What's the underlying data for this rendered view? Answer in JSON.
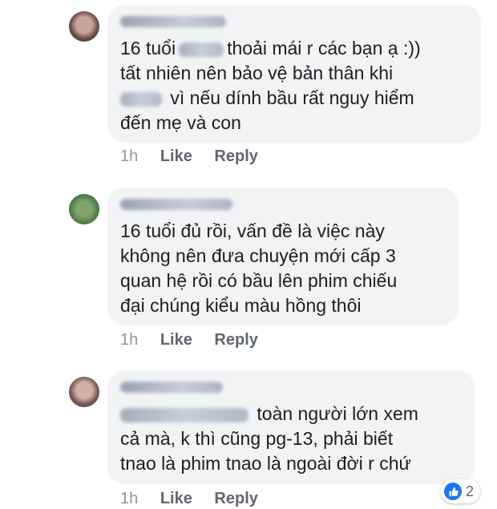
{
  "comments": [
    {
      "text_lines": [
        "16 tuổi",
        "thoải mái r các bạn ạ :))",
        "tất nhiên nên bảo vệ bản thân khi",
        "vì nếu dính bầu rất nguy hiểm",
        "đến mẹ và con"
      ],
      "time": "1h",
      "like_label": "Like",
      "reply_label": "Reply"
    },
    {
      "text_lines": [
        "16 tuổi đủ rồi, vấn đề là việc này",
        "không nên đưa chuyện mới cấp 3",
        "quan hệ rồi có bầu lên phim chiếu",
        "đại chúng kiểu màu hồng thôi"
      ],
      "time": "1h",
      "like_label": "Like",
      "reply_label": "Reply"
    },
    {
      "text_lines": [
        "toàn người lớn xem",
        "cả mà, k thì cũng pg-13, phải biết",
        "tnao là phim tnao là ngoài đời r chứ"
      ],
      "time": "1h",
      "like_label": "Like",
      "reply_label": "Reply",
      "reactions": {
        "icon": "thumbs-up-icon",
        "count": "2",
        "color": "#1877f2"
      }
    }
  ],
  "colors": {
    "bubble": "#f2f3f5",
    "text": "#1c1e21",
    "meta": "#606770",
    "like_blue": "#1877f2"
  }
}
